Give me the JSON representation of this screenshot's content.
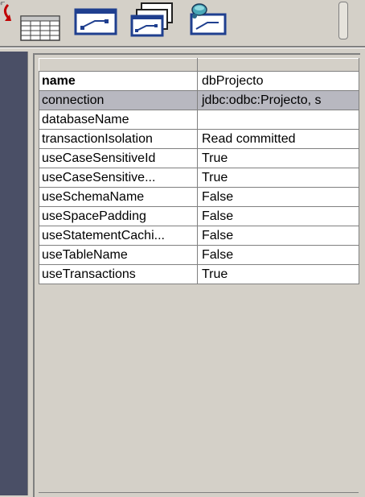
{
  "toolbar": {
    "buttons": [
      {
        "name": "table-refresh-icon"
      },
      {
        "name": "link-icon"
      },
      {
        "name": "multi-link-icon"
      },
      {
        "name": "database-link-icon"
      }
    ]
  },
  "properties": [
    {
      "key": "name",
      "value": "dbProjecto",
      "bold": true,
      "selected": false
    },
    {
      "key": "connection",
      "value": "jdbc:odbc:Projecto, s",
      "bold": false,
      "selected": true
    },
    {
      "key": "databaseName",
      "value": "",
      "bold": false,
      "selected": false
    },
    {
      "key": "transactionIsolation",
      "value": "Read committed",
      "bold": false,
      "selected": false
    },
    {
      "key": "useCaseSensitiveId",
      "value": "True",
      "bold": false,
      "selected": false
    },
    {
      "key": "useCaseSensitive...",
      "value": "True",
      "bold": false,
      "selected": false
    },
    {
      "key": "useSchemaName",
      "value": "False",
      "bold": false,
      "selected": false
    },
    {
      "key": "useSpacePadding",
      "value": "False",
      "bold": false,
      "selected": false
    },
    {
      "key": "useStatementCachi...",
      "value": "False",
      "bold": false,
      "selected": false
    },
    {
      "key": "useTableName",
      "value": "False",
      "bold": false,
      "selected": false
    },
    {
      "key": "useTransactions",
      "value": "True",
      "bold": false,
      "selected": false
    }
  ]
}
